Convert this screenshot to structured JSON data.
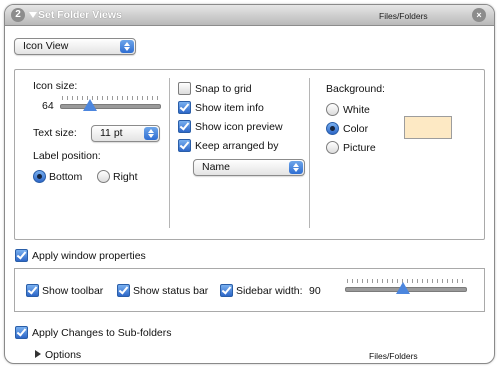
{
  "titlebar": {
    "step_number": "2",
    "title": "Set Folder Views",
    "category": "Files/Folders",
    "close_glyph": "×"
  },
  "view_popup": {
    "selected": "Icon View"
  },
  "icon_size": {
    "label": "Icon size:",
    "value": "64",
    "level": 0.3
  },
  "text_size": {
    "label": "Text size:",
    "selected": "11 pt"
  },
  "label_position": {
    "label": "Label position:",
    "options": [
      "Bottom",
      "Right"
    ],
    "selected": "Bottom"
  },
  "checks": {
    "snap_to_grid": {
      "label": "Snap to grid",
      "checked": false
    },
    "show_item_info": {
      "label": "Show item info",
      "checked": true
    },
    "show_icon_preview": {
      "label": "Show icon preview",
      "checked": true
    },
    "keep_arranged_by": {
      "label": "Keep arranged by",
      "checked": true
    }
  },
  "arrange_popup": {
    "selected": "Name"
  },
  "background": {
    "label": "Background:",
    "options": [
      "White",
      "Color",
      "Picture"
    ],
    "selected": "Color",
    "color": "#fde9c4"
  },
  "window_props": {
    "label": "Apply window properties",
    "checked": true,
    "show_toolbar": {
      "label": "Show toolbar",
      "checked": true
    },
    "show_status_bar": {
      "label": "Show status bar",
      "checked": true
    },
    "sidebar_width": {
      "label": "Sidebar width:",
      "checked": true,
      "value": "90",
      "level": 0.48
    }
  },
  "subfolders": {
    "label": "Apply Changes to Sub-folders",
    "checked": true
  },
  "footer": {
    "options_label": "Options",
    "category": "Files/Folders"
  }
}
